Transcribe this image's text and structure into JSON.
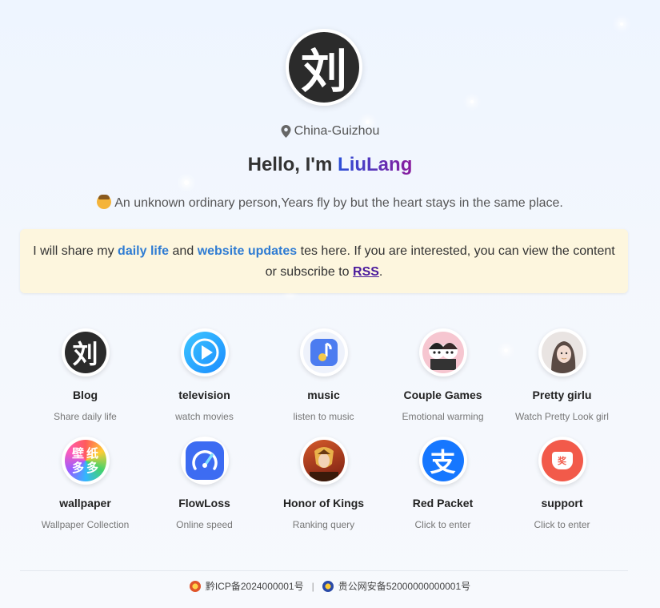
{
  "profile": {
    "avatar_char": "刘",
    "location": "China-Guizhou",
    "greeting_prefix": "Hello, I'm",
    "name": "LiuLang",
    "motto": "An unknown ordinary person,Years fly by but the heart stays in the same place."
  },
  "notice": {
    "part1": "I will share my",
    "hl1": "daily life",
    "part2": "and",
    "hl2": "website updates",
    "part3": "tes here. If you are interested, you can view the content or subscribe to",
    "rss": "RSS",
    "end": "."
  },
  "apps": [
    {
      "title": "Blog",
      "desc": "Share daily life",
      "icon": "liu-avatar-icon"
    },
    {
      "title": "television",
      "desc": "watch movies",
      "icon": "play-icon"
    },
    {
      "title": "music",
      "desc": "listen to music",
      "icon": "music-note-icon"
    },
    {
      "title": "Couple Games",
      "desc": "Emotional warming",
      "icon": "couple-icon"
    },
    {
      "title": "Pretty girlu",
      "desc": "Watch Pretty Look girl",
      "icon": "girl-photo-icon"
    },
    {
      "title": "wallpaper",
      "desc": "Wallpaper Collection",
      "icon": "wallpaper-icon"
    },
    {
      "title": "FlowLoss",
      "desc": "Online speed",
      "icon": "speedometer-icon"
    },
    {
      "title": "Honor of Kings",
      "desc": "Ranking query",
      "icon": "game-hero-icon"
    },
    {
      "title": "Red Packet",
      "desc": "Click to enter",
      "icon": "alipay-icon"
    },
    {
      "title": "support",
      "desc": "Click to enter",
      "icon": "red-envelope-icon"
    }
  ],
  "wallpaper_icon_text": [
    "壁",
    "纸",
    "多",
    "多"
  ],
  "support_icon_text": "奖",
  "alipay_icon_text": "支",
  "footer": {
    "icp": "黔ICP备2024000001号",
    "separator": "|",
    "police": "贵公网安备52000000000001号"
  },
  "colors": {
    "name_gradient_start": "#2a4fd8",
    "name_gradient_end": "#8a1a9c",
    "highlight": "#2f7cd3",
    "notice_bg": "#fdf6de"
  }
}
